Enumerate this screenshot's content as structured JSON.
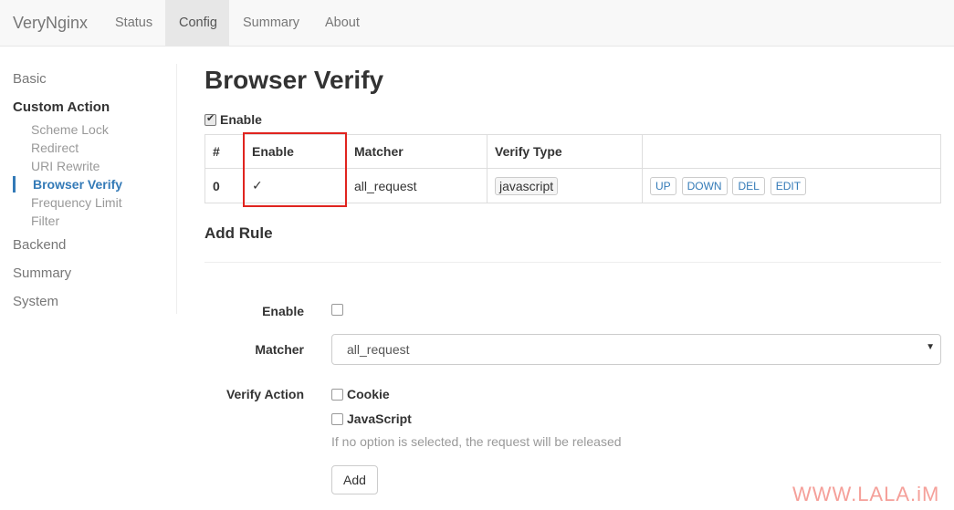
{
  "navbar": {
    "brand": "VeryNginx",
    "items": [
      {
        "label": "Status"
      },
      {
        "label": "Config"
      },
      {
        "label": "Summary"
      },
      {
        "label": "About"
      }
    ]
  },
  "sidebar": {
    "basic": "Basic",
    "custom_action": "Custom Action",
    "sub_items": [
      "Scheme Lock",
      "Redirect",
      "URI Rewrite",
      "Browser Verify",
      "Frequency Limit",
      "Filter"
    ],
    "backend": "Backend",
    "summary": "Summary",
    "system": "System"
  },
  "main": {
    "title": "Browser Verify",
    "enable_label": "Enable",
    "table": {
      "headers": [
        "#",
        "Enable",
        "Matcher",
        "Verify Type",
        ""
      ],
      "rows": [
        {
          "index": "0",
          "enabled": "✓",
          "matcher": "all_request",
          "verify_type": "javascript",
          "actions": [
            "UP",
            "DOWN",
            "DEL",
            "EDIT"
          ]
        }
      ]
    },
    "add_rule": {
      "heading": "Add Rule",
      "enable_label": "Enable",
      "matcher_label": "Matcher",
      "matcher_value": "all_request",
      "verify_action_label": "Verify Action",
      "options": [
        "Cookie",
        "JavaScript"
      ],
      "help_text": "If no option is selected, the request will be released",
      "add_button": "Add"
    }
  },
  "watermark": "WWW.LALA.iM"
}
